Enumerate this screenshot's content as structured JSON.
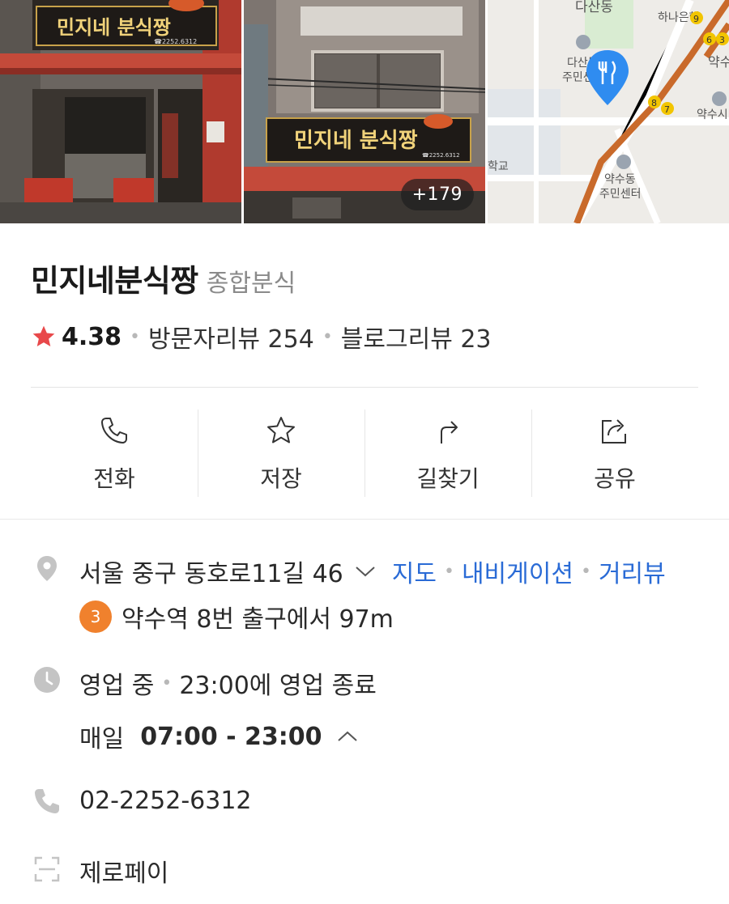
{
  "photos": {
    "more_count": "+179",
    "sign_text": "민지네 분식짱",
    "sign_phone": "☎2252.6312"
  },
  "map": {
    "labels": [
      "다산동",
      "하나은행",
      "약수",
      "다산동 주민센터",
      "약수동 주민센터",
      "약수시",
      "학교"
    ],
    "exit_numbers": [
      "9",
      "6",
      "3",
      "8",
      "7"
    ]
  },
  "place": {
    "name": "민지네분식짱",
    "category": "종합분식",
    "rating": "4.38",
    "visitor_reviews": "방문자리뷰 254",
    "blog_reviews": "블로그리뷰 23"
  },
  "actions": [
    {
      "label": "전화",
      "icon": "phone-icon"
    },
    {
      "label": "저장",
      "icon": "star-outline-icon"
    },
    {
      "label": "길찾기",
      "icon": "directions-icon"
    },
    {
      "label": "공유",
      "icon": "share-icon"
    }
  ],
  "info": {
    "address": "서울 중구 동호로11길 46",
    "map_link": "지도",
    "navigation_link": "내비게이션",
    "street_view_link": "거리뷰",
    "subway_line": "3",
    "subway_text": "약수역 8번 출구에서 97m",
    "status": "영업 중",
    "close_time": "23:00에 영업 종료",
    "hours_day": "매일",
    "hours_range": "07:00 - 23:00",
    "phone": "02-2252-6312",
    "payment": "제로페이"
  },
  "colors": {
    "star": "#e8484a",
    "link": "#2a6bd6",
    "subway_line3": "#f0812d",
    "map_route": "#c96a2b"
  }
}
